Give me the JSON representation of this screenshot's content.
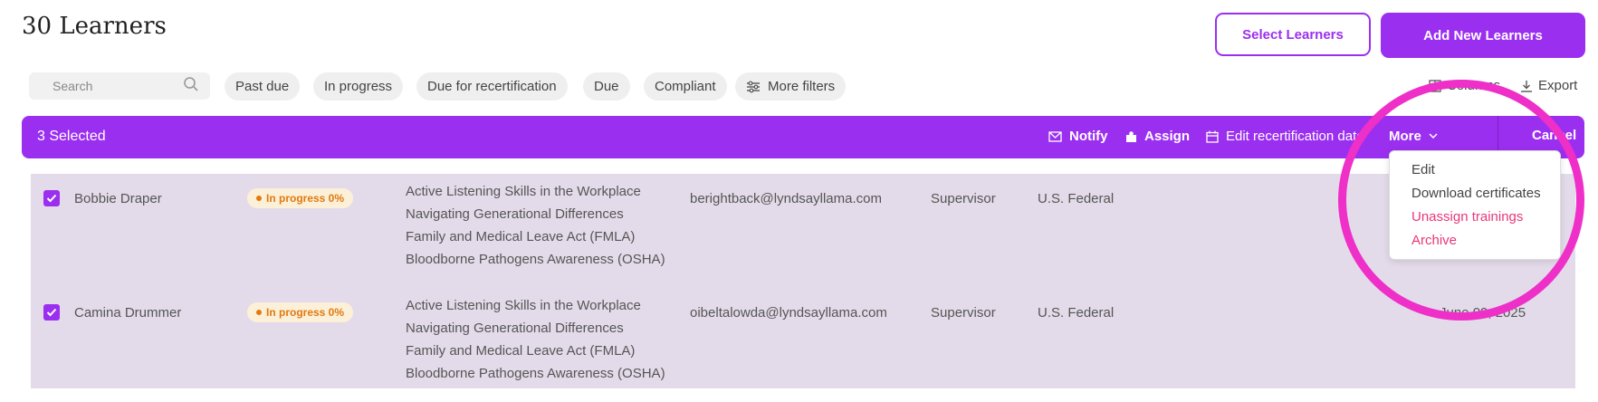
{
  "header": {
    "title": "30 Learners",
    "select_learners_label": "Select Learners",
    "add_new_learners_label": "Add New Learners"
  },
  "filters": {
    "search_placeholder": "Search",
    "chips": [
      "Past due",
      "In progress",
      "Due for recertification",
      "Due",
      "Compliant"
    ],
    "more_filters_label": "More filters",
    "columns_label": "Columns",
    "export_label": "Export"
  },
  "selection_bar": {
    "selected_text": "3 Selected",
    "notify_label": "Notify",
    "assign_label": "Assign",
    "edit_recert_label": "Edit recertification date",
    "more_label": "More",
    "cancel_label": "Cancel"
  },
  "more_menu": {
    "items": [
      "Edit",
      "Download certificates",
      "Unassign trainings",
      "Archive"
    ]
  },
  "rows": [
    {
      "checked": true,
      "name": "Bobbie Draper",
      "status": "In progress 0%",
      "courses": [
        "Active Listening Skills in the Workplace",
        "Navigating Generational Differences",
        "Family and Medical Leave Act (FMLA)",
        "Bloodborne Pathogens Awareness (OSHA)"
      ],
      "email": "berightback@lyndsayllama.com",
      "role": "Supervisor",
      "location": "U.S. Federal",
      "date": ""
    },
    {
      "checked": true,
      "name": "Camina Drummer",
      "status": "In progress 0%",
      "courses": [
        "Active Listening Skills in the Workplace",
        "Navigating Generational Differences",
        "Family and Medical Leave Act (FMLA)",
        "Bloodborne Pathogens Awareness (OSHA)"
      ],
      "email": "oibeltalowda@lyndsayllama.com",
      "role": "Supervisor",
      "location": "U.S. Federal",
      "date": "June 09, 2025"
    }
  ],
  "colors": {
    "accent": "#9b2ff0",
    "annotation": "#ee2fc8",
    "danger": "#e8387a",
    "row_selected_bg": "#e3dbe9",
    "badge_bg": "#fdf0d9",
    "badge_text": "#e07a10"
  }
}
